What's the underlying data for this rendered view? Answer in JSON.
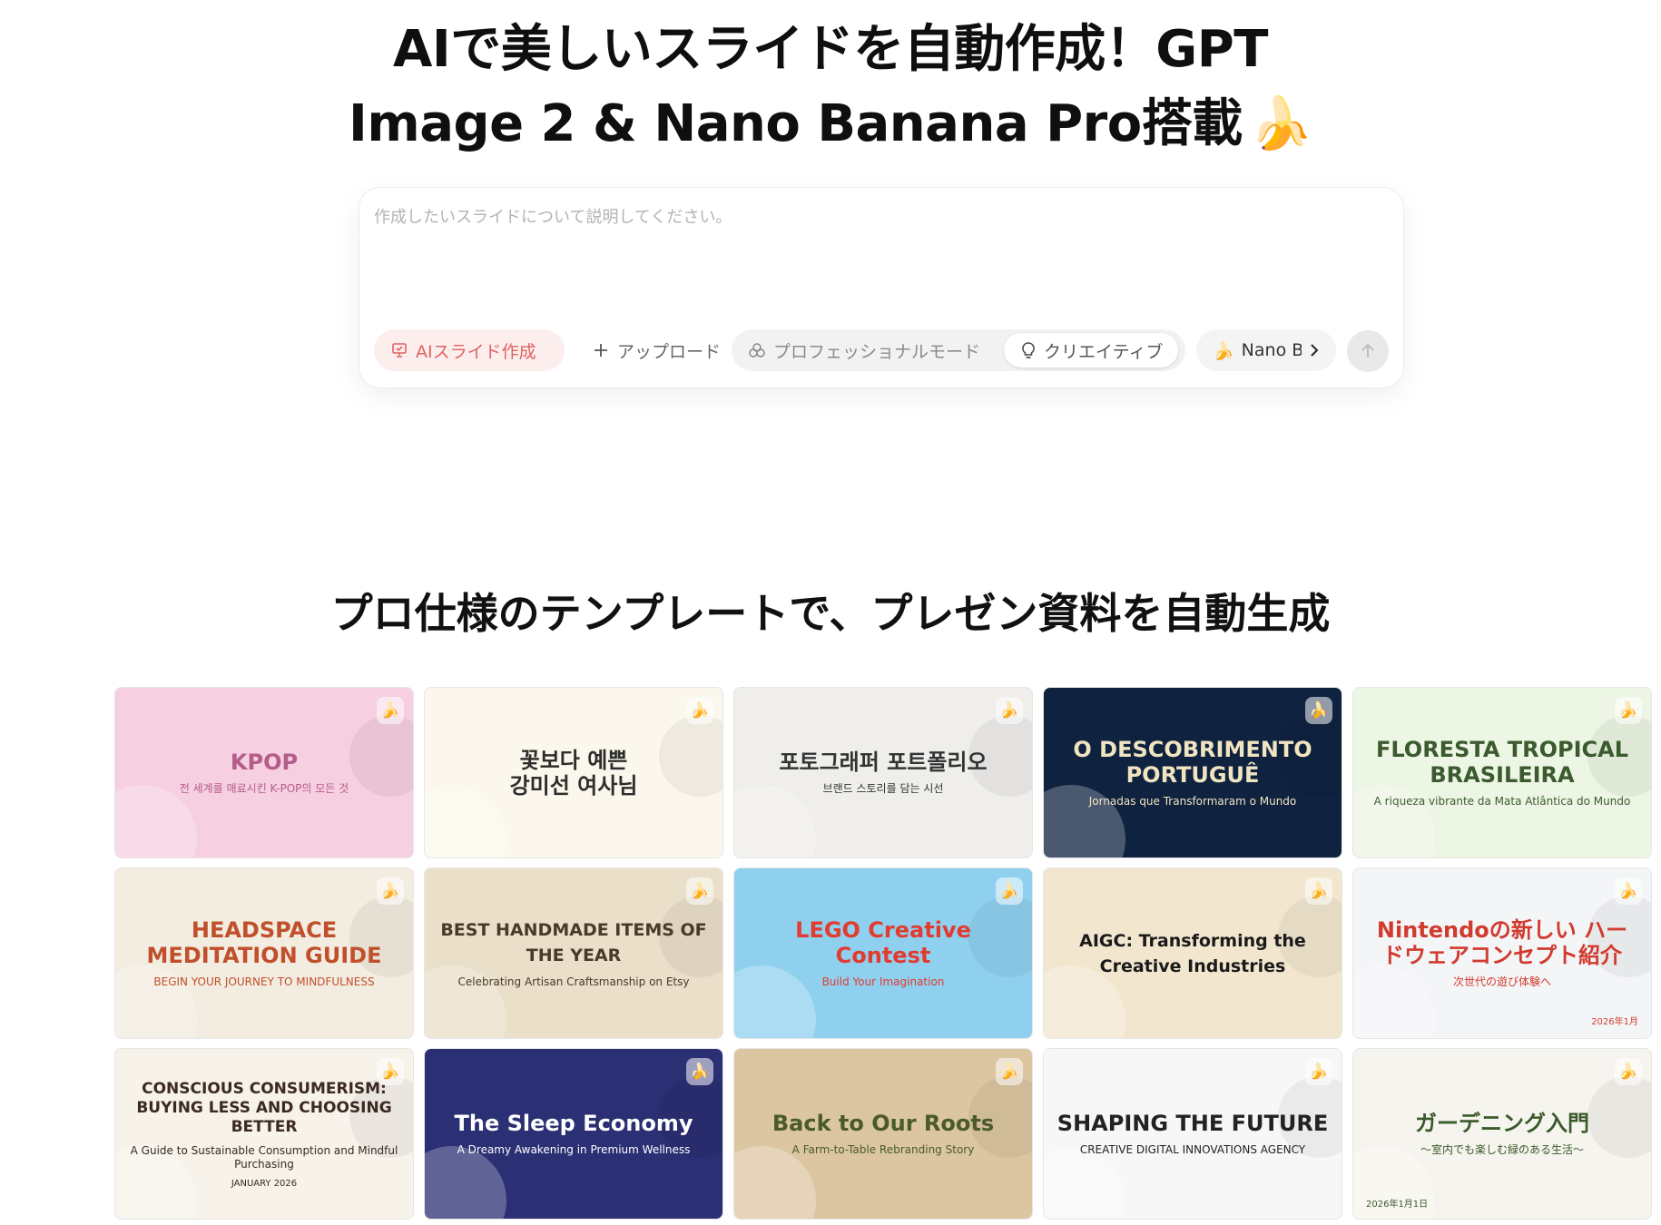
{
  "hero": {
    "line1": "AIで美しいスライドを自動作成！GPT",
    "line2": "Image 2 & Nano Banana Pro搭載",
    "emoji": "🍌"
  },
  "prompt": {
    "placeholder": "作成したいスライドについて説明してください。",
    "value": ""
  },
  "toolbar": {
    "ai_slide_label": "AIスライド作成",
    "upload_label": "アップロード",
    "professional_label": "プロフェッショナルモード",
    "creative_label": "クリエイティブ",
    "model_label": "Nano Banana Pro",
    "model_emoji": "🍌",
    "send_icon": "arrow-up-icon"
  },
  "section": {
    "title": "プロ仕様のテンプレートで、プレゼン資料を自動生成"
  },
  "colors": {
    "accent": "#e0625e",
    "accent_bg": "#fdeeee"
  },
  "templates": [
    {
      "title": "KPOP",
      "subtitle": "전 세계를 매료시킨 K-POP의 모든 것",
      "date": "",
      "badge": "🍌",
      "bg": "#f6cfe0",
      "color": "#b65c8b"
    },
    {
      "title": "꽃보다 예쁜\n강미선 여사님",
      "subtitle": "",
      "date": "",
      "badge": "🍌",
      "bg": "#fbf7ec",
      "color": "#2d2d2d"
    },
    {
      "title": "포토그래퍼 포트폴리오",
      "subtitle": "브랜드 스토리를 담는 시선",
      "date": "",
      "badge": "🍌",
      "bg": "#efeeeb",
      "color": "#333333"
    },
    {
      "title": "O DESCOBRIMENTO PORTUGUÊ",
      "subtitle": "Jornadas que Transformaram o Mundo",
      "date": "",
      "badge": "🍌",
      "bg": "#0f2240",
      "color": "#f1e4c0"
    },
    {
      "title": "FLORESTA TROPICAL BRASILEIRA",
      "subtitle": "A riqueza vibrante da Mata Atlântica do Mundo",
      "date": "",
      "badge": "🍌",
      "bg": "#edf5e4",
      "color": "#3b5b2f"
    },
    {
      "title": "HEADSPACE MEDITATION GUIDE",
      "subtitle": "BEGIN YOUR JOURNEY TO MINDFULNESS",
      "date": "",
      "badge": "🍌",
      "bg": "#f3ece0",
      "color": "#c0502b"
    },
    {
      "title": "BEST HANDMADE ITEMS OF THE YEAR",
      "subtitle": "Celebrating Artisan Craftsmanship on Etsy",
      "date": "",
      "badge": "🍌",
      "bg": "#eadfc9",
      "color": "#4a3a2a"
    },
    {
      "title": "LEGO Creative Contest",
      "subtitle": "Build Your Imagination",
      "date": "",
      "badge": "🍌",
      "bg": "#8fd0ef",
      "color": "#e23b2f"
    },
    {
      "title": "AIGC: Transforming the Creative Industries",
      "subtitle": "",
      "date": "",
      "badge": "🍌",
      "bg": "#f2e6cf",
      "color": "#1a1a1a"
    },
    {
      "title": "Nintendoの新しい ハードウェアコンセプト紹介",
      "subtitle": "次世代の遊び体験へ",
      "date": "2026年1月",
      "badge": "🍌",
      "bg": "#f4f5f7",
      "color": "#d13b2f"
    },
    {
      "title": "CONSCIOUS CONSUMERISM: BUYING LESS AND CHOOSING BETTER",
      "subtitle": "A Guide to Sustainable Consumption and Mindful Purchasing",
      "date": "JANUARY 2026",
      "badge": "🍌",
      "bg": "#f7f2ea",
      "color": "#3a2a22"
    },
    {
      "title": "The Sleep Economy",
      "subtitle": "A Dreamy Awakening in Premium Wellness",
      "date": "",
      "badge": "🍌",
      "bg": "#2b2f73",
      "color": "#ffffff"
    },
    {
      "title": "Back to Our Roots",
      "subtitle": "A Farm-to-Table Rebranding Story",
      "date": "",
      "badge": "🍌",
      "bg": "#dcc6a2",
      "color": "#4a5a2a"
    },
    {
      "title": "SHAPING THE FUTURE",
      "subtitle": "CREATIVE DIGITAL INNOVATIONS AGENCY",
      "date": "",
      "badge": "🍌",
      "bg": "#f7f7f8",
      "color": "#222222"
    },
    {
      "title": "ガーデニング入門",
      "subtitle": "〜室内でも楽しむ緑のある生活〜",
      "date": "2026年1月1日",
      "badge": "🍌",
      "bg": "#f6f4ee",
      "color": "#3a5a2a"
    }
  ]
}
